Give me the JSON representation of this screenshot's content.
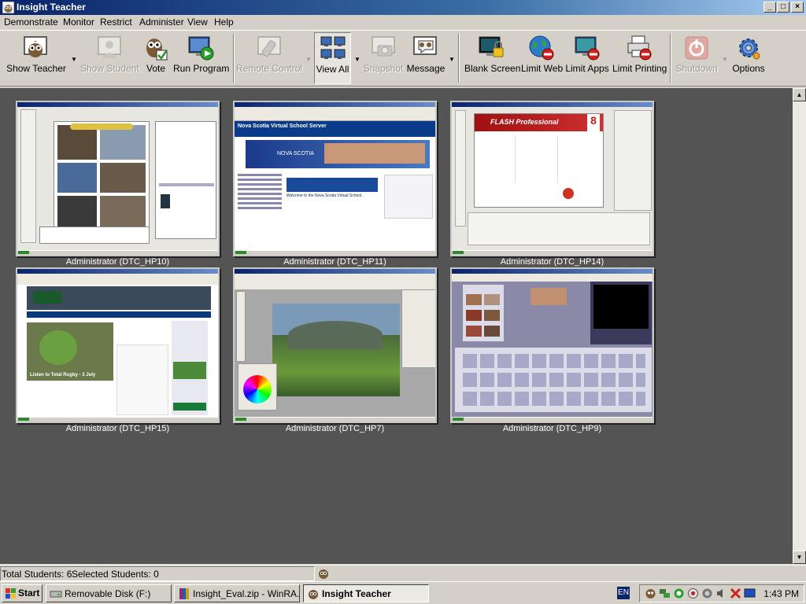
{
  "window": {
    "title": "Insight Teacher",
    "controls": [
      "_",
      "□",
      "×"
    ]
  },
  "menu": [
    "Demonstrate",
    "Monitor",
    "Restrict",
    "Administer",
    "View",
    "Help"
  ],
  "toolbar": [
    {
      "label": "Show Teacher",
      "icon": "owl-board-icon",
      "enabled": true
    },
    {
      "label": "Show Student",
      "icon": "student-icon",
      "enabled": false
    },
    {
      "label": "Vote",
      "icon": "owl-vote-icon",
      "enabled": true
    },
    {
      "label": "Run Program",
      "icon": "run-program-icon",
      "enabled": true
    },
    {
      "label": "Remote Control",
      "icon": "remote-control-icon",
      "enabled": false
    },
    {
      "label": "View All",
      "icon": "view-all-icon",
      "enabled": true,
      "pressed": true
    },
    {
      "label": "Snapshot",
      "icon": "camera-icon",
      "enabled": false
    },
    {
      "label": "Message",
      "icon": "message-icon",
      "enabled": true
    },
    {
      "label": "Blank Screen",
      "icon": "blank-screen-icon",
      "enabled": true
    },
    {
      "label": "Limit Web",
      "icon": "limit-web-icon",
      "enabled": true
    },
    {
      "label": "Limit Apps",
      "icon": "limit-apps-icon",
      "enabled": true
    },
    {
      "label": "Limit Printing",
      "icon": "limit-printing-icon",
      "enabled": true
    },
    {
      "label": "Shutdown",
      "icon": "power-icon",
      "enabled": false
    },
    {
      "label": "Options",
      "icon": "gear-icon",
      "enabled": true
    }
  ],
  "students": [
    {
      "caption": "Administrator (DTC_HP10)",
      "app": "comic-editor"
    },
    {
      "caption": "Administrator (DTC_HP11)",
      "app": "nova-scotia-virtual-school"
    },
    {
      "caption": "Administrator (DTC_HP14)",
      "app": "flash-professional"
    },
    {
      "caption": "Administrator (DTC_HP15)",
      "app": "rugby-site"
    },
    {
      "caption": "Administrator (DTC_HP7)",
      "app": "photo-editor"
    },
    {
      "caption": "Administrator (DTC_HP9)",
      "app": "movie-editor"
    }
  ],
  "screen_text": {
    "hp11_header": "Nova Scotia Virtual School Server",
    "hp11_welcome": "Welcome to the Nova Scotia Virtual School.",
    "hp11_banner": "NOVA SCOTIA",
    "hp14_title": "FLASH Professional",
    "hp14_version": "8",
    "hp15_headline": "Listen to Total Rugby - 3 July"
  },
  "status": {
    "total": "Total Students: 6",
    "selected": "Selected Students: 0"
  },
  "taskbar": {
    "start": "Start",
    "tasks": [
      {
        "label": "Removable Disk (F:)",
        "active": false
      },
      {
        "label": "Insight_Eval.zip - WinRA...",
        "active": false
      },
      {
        "label": "Insight Teacher",
        "active": true
      }
    ],
    "lang": "EN",
    "clock": "1:43 PM"
  }
}
